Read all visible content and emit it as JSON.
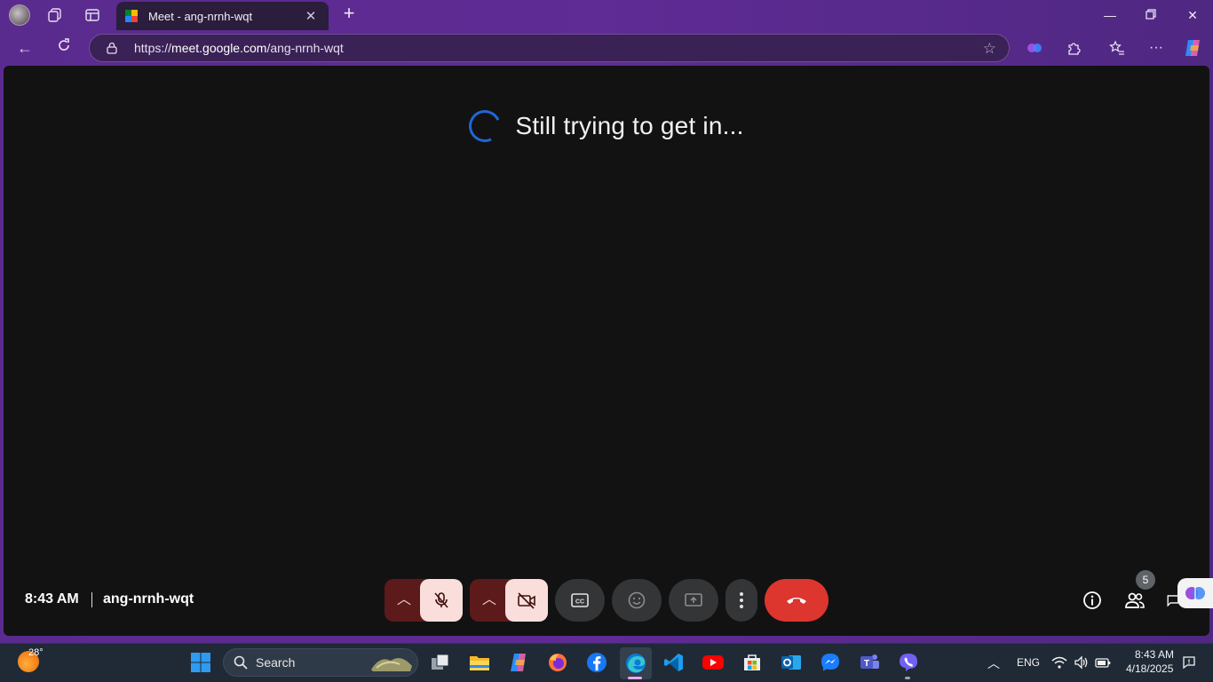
{
  "browser": {
    "tab": {
      "title": "Meet - ang-nrnh-wqt",
      "favicon": "google-meet-icon"
    },
    "new_tab_icon": "plus-icon",
    "url": {
      "scheme": "https://",
      "host": "meet.google.com",
      "path": "/ang-nrnh-wqt"
    },
    "colors": {
      "frame": "#5b2a8c",
      "tab": "#2b1d3c"
    }
  },
  "meet": {
    "status_text": "Still trying to get in...",
    "time": "8:43 AM",
    "meeting_code": "ang-nrnh-wqt",
    "participants_count": "5",
    "controls": [
      {
        "name": "audio-options",
        "icon": "chevron-up-icon"
      },
      {
        "name": "microphone",
        "icon": "mic-off-icon",
        "state": "off"
      },
      {
        "name": "video-options",
        "icon": "chevron-up-icon"
      },
      {
        "name": "camera",
        "icon": "camera-off-icon",
        "state": "off"
      },
      {
        "name": "captions",
        "icon": "captions-icon"
      },
      {
        "name": "reactions",
        "icon": "emoji-icon"
      },
      {
        "name": "present",
        "icon": "present-screen-icon"
      },
      {
        "name": "more-options",
        "icon": "more-vert-icon"
      },
      {
        "name": "leave-call",
        "icon": "call-end-icon"
      }
    ],
    "colors": {
      "background": "#121212",
      "end_call": "#dc362e",
      "muted_bg": "#f9dedc",
      "muted_dark": "#5c1a1a",
      "spinner": "#1f67d6"
    }
  },
  "taskbar": {
    "weather_temp": "28°",
    "search_label": "Search",
    "language": "ENG",
    "clock_time": "8:43 AM",
    "clock_date": "4/18/2025",
    "pinned": [
      "task-view",
      "file-explorer",
      "copilot",
      "firefox",
      "facebook",
      "edge",
      "vscode",
      "youtube",
      "microsoft-store",
      "outlook",
      "messenger",
      "teams",
      "viber"
    ]
  }
}
